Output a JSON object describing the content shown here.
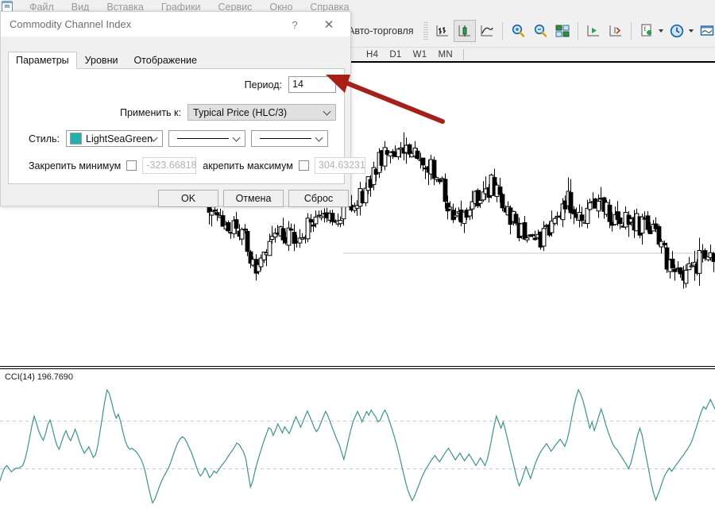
{
  "app": {
    "icon": "mt4-app-icon",
    "menu": [
      "Файл",
      "Вид",
      "Вставка",
      "Графики",
      "Сервис",
      "Окно",
      "Справка"
    ]
  },
  "toolbar": {
    "autotrade_label": "Авто-торговля",
    "icons": [
      {
        "name": "bar-chart-icon",
        "label": "Бары"
      },
      {
        "name": "candlestick-chart-icon",
        "label": "Японские свечи"
      },
      {
        "name": "line-chart-icon",
        "label": "Линейный график"
      },
      {
        "name": "zoom-in-icon",
        "label": "Увеличить"
      },
      {
        "name": "zoom-out-icon",
        "label": "Уменьшить"
      },
      {
        "name": "tile-windows-icon",
        "label": "Упорядочить окна"
      },
      {
        "name": "auto-scroll-icon",
        "label": "Автопрокрутка"
      },
      {
        "name": "chart-shift-icon",
        "label": "Сдвиг графика"
      },
      {
        "name": "indicators-icon",
        "label": "Индикаторы"
      },
      {
        "name": "period-icon",
        "label": "Период"
      },
      {
        "name": "templates-icon",
        "label": "Шаблоны"
      }
    ],
    "timeframes": [
      "H4",
      "D1",
      "W1",
      "MN"
    ]
  },
  "dialog": {
    "title": "Commodity Channel Index",
    "help_glyph": "?",
    "close_glyph": "✕",
    "tabs": [
      {
        "label": "Параметры",
        "selected": true
      },
      {
        "label": "Уровни",
        "selected": false
      },
      {
        "label": "Отображение",
        "selected": false
      }
    ],
    "fields": {
      "period_label": "Период:",
      "period_value": "14",
      "apply_to_label": "Применить к:",
      "apply_to_value": "Typical Price (HLC/3)",
      "style_label": "Стиль:",
      "style_color_name": "LightSeaGreen",
      "style_color_hex": "#20B2AA",
      "fix_min_label": "Закрепить минимум",
      "fix_min_value": "-323.66818",
      "fix_min_checked": false,
      "fix_max_label": "акрепить максимум",
      "fix_max_value": "304.63231",
      "fix_max_checked": false
    },
    "buttons": {
      "ok": "OK",
      "cancel": "Отмена",
      "reset": "Сброс"
    }
  },
  "indicator_pane": {
    "label": "CCI(14) 196.7690",
    "line_color": "#3a9490",
    "level_color": "#c8c8c8"
  },
  "annotation": {
    "arrow_color": "#A81F17",
    "name": "red-arrow-pointing-to-period-field"
  },
  "chart_data": {
    "type": "line",
    "title": "CCI(14) 196.7690",
    "xlabel": "",
    "ylabel": "",
    "ylim": [
      -300,
      300
    ],
    "grid": false,
    "levels": [
      100,
      -100
    ],
    "series": [
      {
        "name": "CCI(14)",
        "color": "#3a9490",
        "values": [
          -150,
          -118,
          -96,
          -86,
          -98,
          -112,
          -104,
          -96,
          -98,
          -92,
          -86,
          -60,
          -20,
          30,
          80,
          120,
          92,
          58,
          36,
          20,
          46,
          86,
          104,
          70,
          30,
          -2,
          -18,
          12,
          40,
          60,
          34,
          18,
          40,
          66,
          40,
          10,
          -14,
          -34,
          -22,
          -8,
          -30,
          -52,
          -40,
          0,
          60,
          120,
          180,
          230,
          214,
          180,
          140,
          112,
          128,
          96,
          54,
          18,
          -6,
          -18,
          -14,
          -22,
          -30,
          -44,
          -60,
          -86,
          -120,
          -166,
          -208,
          -242,
          -226,
          -200,
          -174,
          -150,
          -130,
          -114,
          -96,
          -72,
          -44,
          -16,
          8,
          24,
          34,
          28,
          12,
          -10,
          -30,
          -56,
          -84,
          -112,
          -130,
          -118,
          -96,
          -112,
          -136,
          -126,
          -108,
          -118,
          -104,
          -90,
          -78,
          -66,
          -50,
          -36,
          -24,
          -8,
          8,
          2,
          -14,
          -30,
          -60,
          -120,
          -176,
          -150,
          -108,
          -72,
          -40,
          -10,
          20,
          46,
          72,
          66,
          40,
          62,
          88,
          70,
          50,
          76,
          62,
          48,
          70,
          96,
          118,
          96,
          74,
          96,
          120,
          142,
          120,
          96,
          72,
          56,
          70,
          94,
          118,
          140,
          122,
          96,
          70,
          46,
          22,
          0,
          -30,
          -60,
          -22,
          20,
          60,
          96,
          118,
          140,
          120,
          96,
          118,
          140,
          124,
          146,
          130,
          118,
          96,
          104,
          128,
          146,
          128,
          100,
          72,
          40,
          8,
          -30,
          -70,
          -110,
          -150,
          -186,
          -210,
          -232,
          -214,
          -190,
          -166,
          -140,
          -120,
          -100,
          -86,
          -70,
          -56,
          -44,
          -58,
          -70,
          -56,
          -40,
          -26,
          -14,
          -30,
          -46,
          -62,
          -48,
          -34,
          -50,
          -66,
          -52,
          -38,
          -54,
          -70,
          -86,
          -70,
          -54,
          -70,
          -86,
          -60,
          -20,
          30,
          80,
          120,
          96,
          70,
          96,
          60,
          20,
          -20,
          -60,
          -100,
          -140,
          -170,
          -150,
          -120,
          -90,
          -116,
          -140,
          -110,
          -80,
          -56,
          -36,
          -20,
          -8,
          6,
          -10,
          -26,
          -14,
          0,
          12,
          24,
          10,
          -6,
          20,
          60,
          110,
          160,
          200,
          230,
          212,
          186,
          150,
          110,
          70,
          96,
          60,
          90,
          120,
          150,
          120,
          86,
          56,
          30,
          6,
          -10,
          -20,
          -36,
          -50,
          -66,
          -80,
          -100,
          -78,
          -40,
          0,
          40,
          70,
          40,
          -10,
          -60,
          -110,
          -160,
          -200,
          -230,
          -206,
          -180,
          -150,
          -126,
          -110,
          -96,
          -110,
          -96,
          -82,
          -70,
          -56,
          -44,
          -30,
          -16,
          0,
          20,
          50,
          80,
          110,
          140,
          160,
          150,
          170,
          190,
          170,
          150
        ]
      }
    ]
  },
  "price_chart": {
    "type": "candlestick",
    "style": "hollow-black-white",
    "note": "OHLC candlesticks, black bodies for down bars, hollow bodies for up bars"
  }
}
